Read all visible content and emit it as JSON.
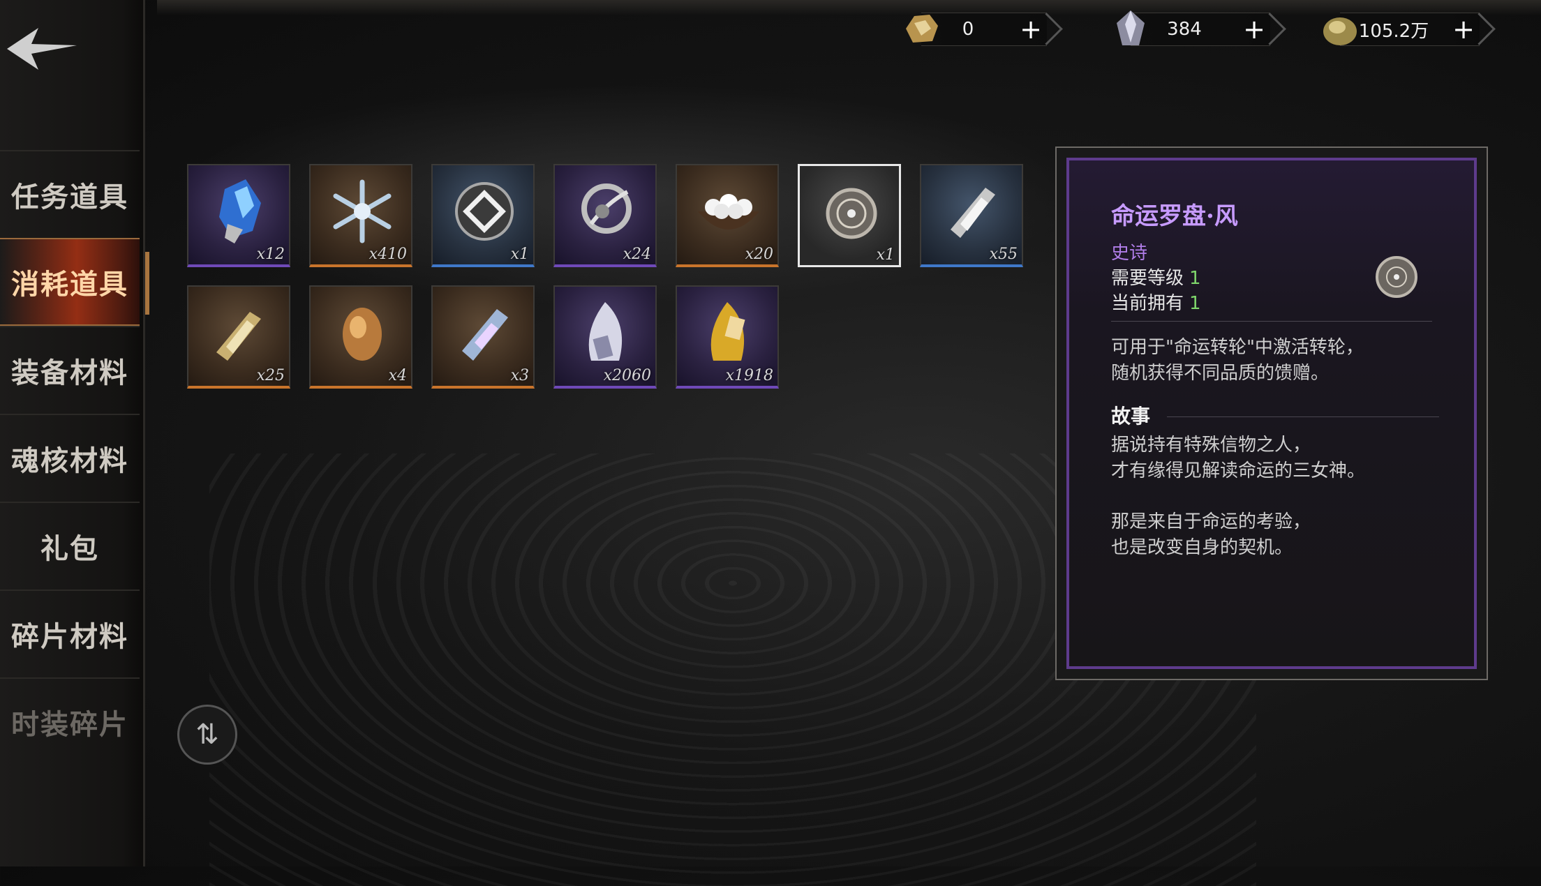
{
  "currencies": [
    {
      "name": "gold-ore-icon",
      "value": "0"
    },
    {
      "name": "crystal-icon",
      "value": "384"
    },
    {
      "name": "gold-nugget-icon",
      "value": "105.2万"
    }
  ],
  "sidebar": {
    "items": [
      {
        "label": "任务道具",
        "state": "normal"
      },
      {
        "label": "消耗道具",
        "state": "active"
      },
      {
        "label": "装备材料",
        "state": "normal"
      },
      {
        "label": "魂核材料",
        "state": "normal"
      },
      {
        "label": "礼包",
        "state": "normal"
      },
      {
        "label": "碎片材料",
        "state": "normal"
      },
      {
        "label": "时装碎片",
        "state": "dim"
      }
    ]
  },
  "grid": {
    "items": [
      {
        "icon": "blue-crystal-icon",
        "qty": "x12",
        "rarity": "purple"
      },
      {
        "icon": "snowflake-icon",
        "qty": "x410",
        "rarity": "orange"
      },
      {
        "icon": "rune-token-icon",
        "qty": "x1",
        "rarity": "blue"
      },
      {
        "icon": "silver-amulet-icon",
        "qty": "x24",
        "rarity": "purple"
      },
      {
        "icon": "rice-bowl-icon",
        "qty": "x20",
        "rarity": "orange"
      },
      {
        "icon": "fate-compass-icon",
        "qty": "x1",
        "rarity": "gray"
      },
      {
        "icon": "silver-shard-icon",
        "qty": "x55",
        "rarity": "blue"
      },
      {
        "icon": "gold-shard-icon",
        "qty": "x25",
        "rarity": "orange"
      },
      {
        "icon": "amber-egg-icon",
        "qty": "x4",
        "rarity": "orange"
      },
      {
        "icon": "prismatic-shard-icon",
        "qty": "x3",
        "rarity": "orange"
      },
      {
        "icon": "white-flame-card-icon",
        "qty": "x2060",
        "rarity": "purple"
      },
      {
        "icon": "gold-flame-card-icon",
        "qty": "x1918",
        "rarity": "purple"
      }
    ]
  },
  "detail": {
    "title": "命运罗盘·风",
    "rarity": "史诗",
    "level_label": "需要等级",
    "level_value": "1",
    "owned_label": "当前拥有",
    "owned_value": "1",
    "desc_1": "可用于\"命运转轮\"中激活转轮，",
    "desc_2": "随机获得不同品质的馈赠。",
    "story_heading": "故事",
    "story_1": "据说持有特殊信物之人，",
    "story_2": "才有缘得见解读命运的三女神。",
    "story_3": "那是来自于命运的考验，",
    "story_4": "也是改变自身的契机。"
  },
  "colors": {
    "accent_purple": "#c79bff",
    "owned_green": "#7fd66b",
    "active_tab": "#aa3214"
  }
}
